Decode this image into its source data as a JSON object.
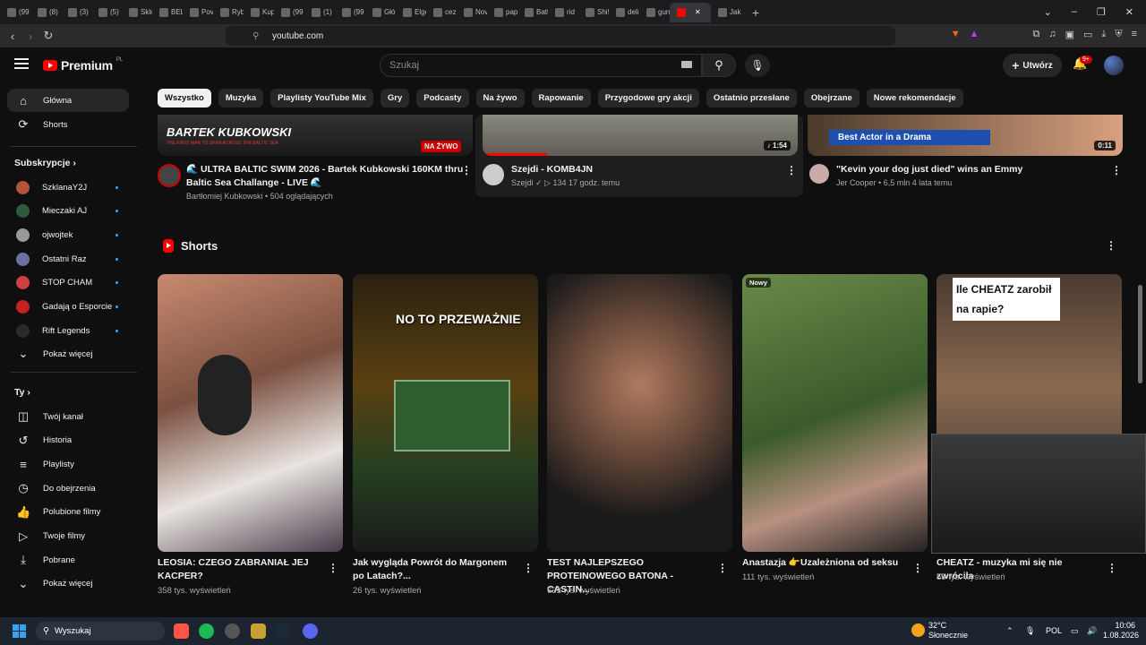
{
  "browser": {
    "tabs": [
      "(99",
      "(8)",
      "(3)",
      "(5)",
      "Sklo",
      "BEL",
      "Pov",
      "Ryb",
      "Kup",
      "(99",
      "(1)",
      "(99",
      "Głó",
      "Elgo",
      "cez",
      "Nov",
      "pap",
      "Batt",
      "rid",
      "Shi!",
      "deli",
      "gun",
      "",
      "Jak"
    ],
    "url": "youtube.com"
  },
  "header": {
    "brand": "Premium",
    "region": "PL",
    "search_placeholder": "Szukaj",
    "create_label": "Utwórz",
    "notif_badge": "9+"
  },
  "sidebar": {
    "main": [
      {
        "label": "Główna",
        "icon": "home-icon"
      },
      {
        "label": "Shorts",
        "icon": "shorts-icon"
      }
    ],
    "subs_title": "Subskrypcje",
    "subs": [
      {
        "label": "SzklanaY2J",
        "color": "#b5523a"
      },
      {
        "label": "Mieczaki AJ",
        "color": "#2d5c3a"
      },
      {
        "label": "ojwojtek",
        "color": "#999"
      },
      {
        "label": "Ostatni Raz",
        "color": "#6f6fa8"
      },
      {
        "label": "STOP CHAM",
        "color": "#d04040"
      },
      {
        "label": "Gadają o Esporcie",
        "color": "#c82020"
      },
      {
        "label": "Rift Legends",
        "color": "#2a2a2a"
      }
    ],
    "show_more": "Pokaż więcej",
    "you_title": "Ty",
    "you": [
      {
        "label": "Twój kanał",
        "icon": "channel-icon"
      },
      {
        "label": "Historia",
        "icon": "history-icon"
      },
      {
        "label": "Playlisty",
        "icon": "playlist-icon"
      },
      {
        "label": "Do obejrzenia",
        "icon": "watch-later-icon"
      },
      {
        "label": "Polubione filmy",
        "icon": "like-icon"
      },
      {
        "label": "Twoje filmy",
        "icon": "your-videos-icon"
      },
      {
        "label": "Pobrane",
        "icon": "download-icon"
      }
    ],
    "you_more": "Pokaż więcej"
  },
  "chips": [
    "Wszystko",
    "Muzyka",
    "Playlisty YouTube Mix",
    "Gry",
    "Podcasty",
    "Na żywo",
    "Rapowanie",
    "Przygodowe gry akcji",
    "Ostatnio przesłane",
    "Obejrzane",
    "Nowe rekomendacje"
  ],
  "videos": [
    {
      "title1": "🌊 ULTRA BALTIC SWIM 2026 - Bartek Kubkowski 160KM thru",
      "title2": "Baltic Sea Challange - LIVE 🌊",
      "channel": "Bartłomiej Kubkowski",
      "meta": "504 oglądających",
      "badge": "NA ŻYWO",
      "thumb_text": "BARTEK KUBKOWSKI",
      "thumb_sub": "THE FIRST MAN TO SWIM ACROSS THE BALTIC SEA"
    },
    {
      "title1": "Szejdi - KOMB4JN",
      "channel": "Szejdi",
      "meta": "▷ 134   17 godz. temu",
      "duration": "1:54"
    },
    {
      "title1": "\"Kevin your dog just died\" wins an Emmy",
      "channel": "Jer Cooper",
      "meta": "6,5 mln   4 lata temu",
      "duration": "0:11",
      "thumb_text": "Best Actor in a Drama"
    }
  ],
  "shorts": {
    "title": "Shorts",
    "items": [
      {
        "title": "LEOSIA: CZEGO ZABRANIAŁ JEJ KACPER?",
        "views": "358 tys. wyświetleń"
      },
      {
        "title": "Jak wygląda Powrót do Margonem po Latach?...",
        "views": "26 tys. wyświetleń",
        "overlay": "NO TO PRZEWAŻNIE"
      },
      {
        "title": "TEST NAJLEPSZEGO PROTEINOWEGO BATONA - CASTIN...",
        "views": "632 tys. wyświetleń"
      },
      {
        "title": "Anastazja 👉Uzależniona od seksu",
        "views": "111 tys. wyświetleń",
        "tag": "Nowy"
      },
      {
        "title": "CHEATZ - muzyka mi się nie zwróciła",
        "views": "65 tys. wyświetleń",
        "overlay": "Ile CHEATZ zarobił na rapie?"
      }
    ]
  },
  "taskbar": {
    "search": "Wyszukaj",
    "weather_temp": "32°C",
    "weather_desc": "Słonecznie",
    "lang": "POL",
    "time": "10:06",
    "date": "1.08.2026"
  }
}
